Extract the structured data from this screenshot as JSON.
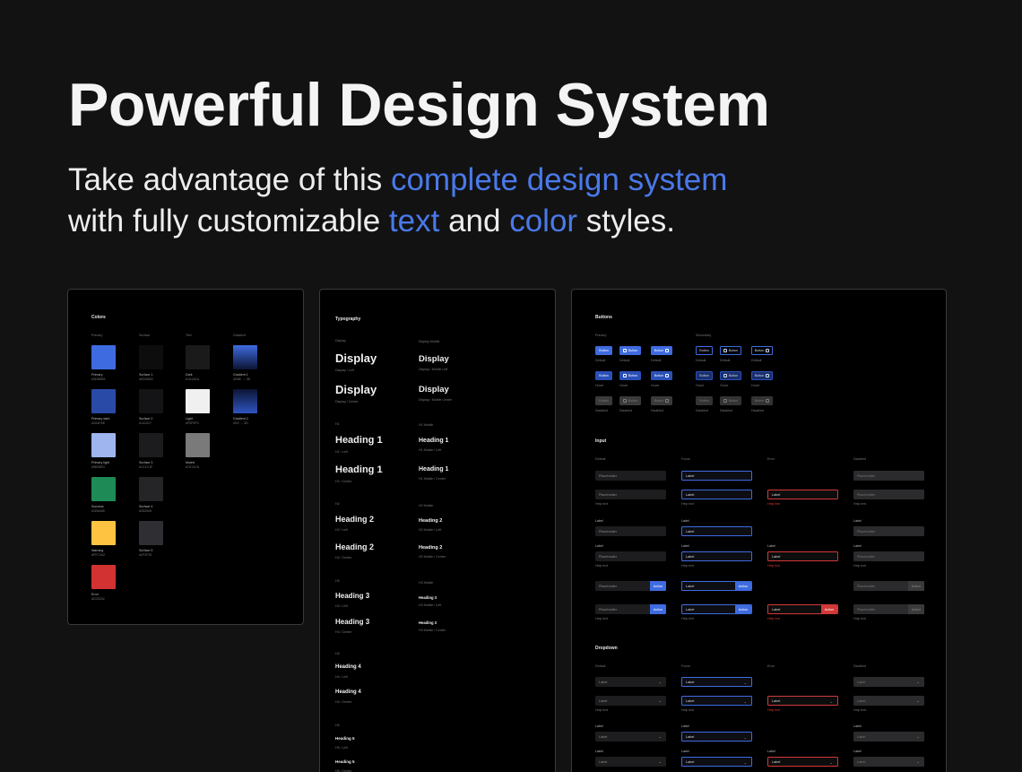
{
  "hero": {
    "title": "Powerful Design System",
    "sub1_a": "Take advantage of this ",
    "sub1_b": "complete design system",
    "sub2_a": "with fully customizable ",
    "sub2_b": "text",
    "sub2_c": " and ",
    "sub2_d": "color",
    "sub2_e": " styles.",
    "accent_color": "#4a79ea"
  },
  "colors": {
    "title": "Colors",
    "cols": [
      "Primary",
      "Surface",
      "Text",
      "Gradient"
    ],
    "swatches": [
      {
        "label": "Primary",
        "hex": "#3D6EE6",
        "color": "#3e6be0"
      },
      {
        "label": "Primary dark",
        "hex": "#2A4FAE",
        "color": "#2a4aa8"
      },
      {
        "label": "Primary light",
        "hex": "#9EB6F0",
        "color": "#9fb5f0"
      },
      {
        "label": "Success",
        "hex": "#1E8A55",
        "color": "#1e8a55"
      },
      {
        "label": "Warning",
        "hex": "#FFC342",
        "color": "#ffc342"
      },
      {
        "label": "Error",
        "hex": "#D23232",
        "color": "#d23232"
      },
      {
        "label": "Surface 1",
        "hex": "#0D0D0D",
        "color": "#0d0d0d"
      },
      {
        "label": "Surface 2",
        "hex": "#141417",
        "color": "#141417"
      },
      {
        "label": "Surface 3",
        "hex": "#1C1C1F",
        "color": "#1c1c1f"
      },
      {
        "label": "Surface 4",
        "hex": "#252528",
        "color": "#252528"
      },
      {
        "label": "Surface 5",
        "hex": "#2F2F33",
        "color": "#2f2f33"
      },
      {
        "label": "Dark",
        "hex": "#1A1A1A",
        "color": "#1a1a1a"
      },
      {
        "label": "Light",
        "hex": "#F0F0F0",
        "color": "#f0f0f0"
      },
      {
        "label": "Muted",
        "hex": "#7A7A7A",
        "color": "#7a7a7a"
      },
      {
        "label": "Gradient 1",
        "hex": "3D6E → 0D",
        "color": "linear-gradient(180deg,#3e6be0,#0b1433)"
      },
      {
        "label": "Gradient 2",
        "hex": "0D0 → 3D",
        "color": "linear-gradient(180deg,#0b1433,#2f55c0)"
      }
    ]
  },
  "typography": {
    "title": "Typography",
    "col_left": "Display",
    "col_right": "Display Mobile",
    "items": [
      {
        "text": "Display",
        "size": 13,
        "cap": "Display / Left",
        "sub": "Display"
      },
      {
        "text": "Display",
        "size": 13,
        "cap": "Display / Center"
      },
      {
        "text": "Heading 1",
        "size": 11,
        "cap": "H1 / Left",
        "sub": "H1"
      },
      {
        "text": "Heading 1",
        "size": 11,
        "cap": "H1 / Center"
      },
      {
        "text": "Heading 2",
        "size": 9,
        "cap": "H2 / Left",
        "sub": "H2"
      },
      {
        "text": "Heading 2",
        "size": 9,
        "cap": "H2 / Center"
      },
      {
        "text": "Heading 3",
        "size": 8,
        "cap": "H3 / Left",
        "sub": "H3"
      },
      {
        "text": "Heading 3",
        "size": 8,
        "cap": "H3 / Center"
      },
      {
        "text": "Heading 4",
        "size": 6,
        "cap": "H4 / Left",
        "sub": "H4"
      },
      {
        "text": "Heading 4",
        "size": 6,
        "cap": "H4 / Center"
      },
      {
        "text": "Heading 5",
        "size": 4.5,
        "cap": "H5 / Left",
        "sub": "H5"
      },
      {
        "text": "Heading 5",
        "size": 4.5,
        "cap": "H5 / Center"
      }
    ],
    "mobile": [
      {
        "text": "Display",
        "size": 9.5,
        "cap": "Display / Mobile Left",
        "sub": "Display Mobile"
      },
      {
        "text": "Display",
        "size": 9.5,
        "cap": "Display / Mobile Center"
      },
      {
        "text": "Heading 1",
        "size": 7,
        "cap": "H1 Mobile / Left",
        "sub": "H1 Mobile"
      },
      {
        "text": "Heading 1",
        "size": 7,
        "cap": "H1 Mobile / Center"
      },
      {
        "text": "Heading 2",
        "size": 5.5,
        "cap": "H2 Mobile / Left",
        "sub": "H2 Mobile"
      },
      {
        "text": "Heading 2",
        "size": 5.5,
        "cap": "H2 Mobile / Center"
      },
      {
        "text": "Heading 3",
        "size": 4.2,
        "cap": "H3 Mobile / Left",
        "sub": "H3 Mobile"
      },
      {
        "text": "Heading 3",
        "size": 4.2,
        "cap": "H3 Mobile / Center"
      }
    ]
  },
  "buttons": {
    "title": "Buttons",
    "primary": "Primary",
    "secondary": "Secondary",
    "btn_label": "Button",
    "states": [
      "Default",
      "Hover",
      "Disabled"
    ],
    "input_title": "Input",
    "input_states": [
      "Default",
      "Focus",
      "Error",
      "Disabled"
    ],
    "placeholder": "Placeholder",
    "label": "Label",
    "help": "Help text",
    "action": "Action",
    "dropdown_title": "Dropdown"
  }
}
